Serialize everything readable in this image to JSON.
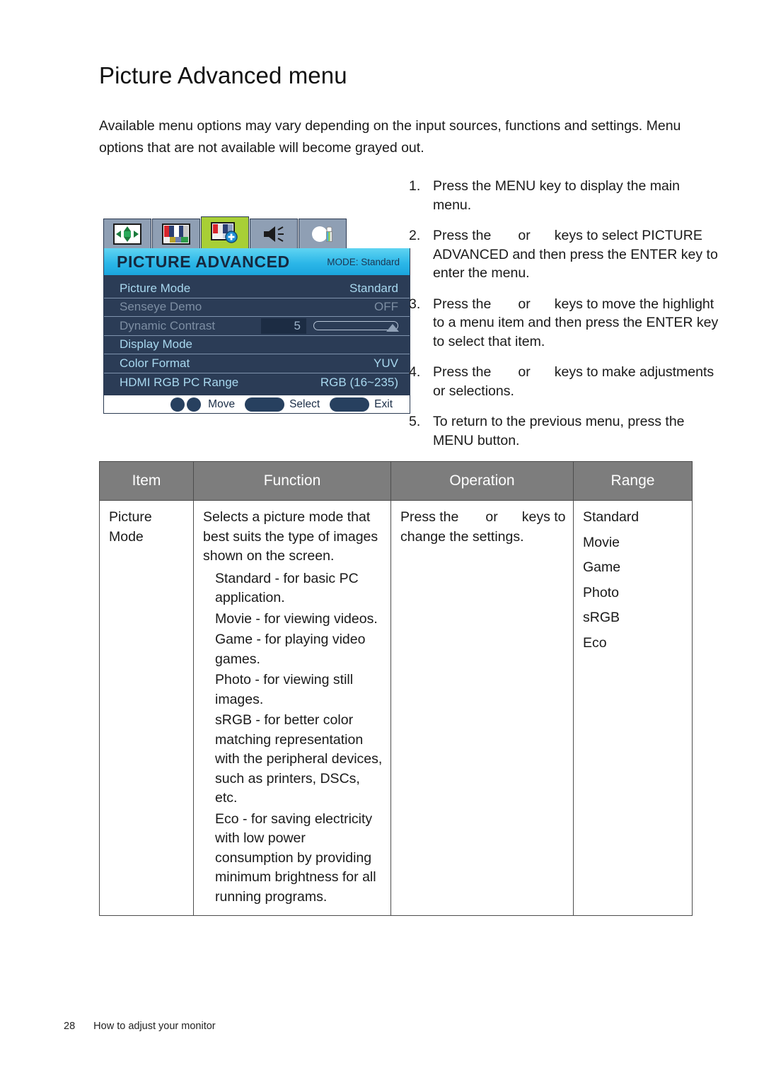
{
  "page": {
    "title": "Picture Advanced menu",
    "intro_line1": "Available menu options may vary depending on the input sources, functions and settings. Menu",
    "intro_line2": "options that are not available will become grayed out."
  },
  "osd": {
    "tabs": [
      {
        "name": "display-tab",
        "icon": "display-arrows-icon",
        "active": false
      },
      {
        "name": "picture-tab",
        "icon": "color-bars-icon",
        "active": false
      },
      {
        "name": "picture-advanced-tab",
        "icon": "color-bars-plus-icon",
        "active": true
      },
      {
        "name": "audio-tab",
        "icon": "speaker-icon",
        "active": false
      },
      {
        "name": "system-tab",
        "icon": "tools-icon",
        "active": false
      }
    ],
    "header_title": "PICTURE ADVANCED",
    "header_mode": "MODE: Standard",
    "rows": [
      {
        "label": "Picture Mode",
        "value": "Standard",
        "dim": false,
        "type": "value"
      },
      {
        "label": "Senseye Demo",
        "value": "OFF",
        "dim": true,
        "type": "value"
      },
      {
        "label": "Dynamic Contrast",
        "value": "5",
        "dim": true,
        "type": "slider"
      },
      {
        "label": "Display Mode",
        "value": "",
        "dim": false,
        "type": "value"
      },
      {
        "label": "Color Format",
        "value": "YUV",
        "dim": false,
        "type": "value"
      },
      {
        "label": "HDMI RGB PC Range",
        "value": "RGB (16~235)",
        "dim": false,
        "type": "value"
      }
    ],
    "footer": {
      "move_label": "Move",
      "select_label": "Select",
      "exit_label": "Exit"
    }
  },
  "steps": [
    {
      "num": "1.",
      "pre": "Press the MENU key to display the main menu.",
      "mid": "",
      "post": ""
    },
    {
      "num": "2.",
      "pre": "Press the",
      "mid": "or",
      "post": "keys to select PICTURE ADVANCED and then press the ENTER key to enter the menu."
    },
    {
      "num": "3.",
      "pre": "Press the",
      "mid": "or",
      "post": "keys to move the highlight to a menu item and then press the ENTER key to select that item."
    },
    {
      "num": "4.",
      "pre": "Press the",
      "mid": "or",
      "post": "keys to make adjustments or selections."
    },
    {
      "num": "5.",
      "pre": "To return to the previous menu, press the MENU button.",
      "mid": "",
      "post": ""
    }
  ],
  "table": {
    "headers": [
      "Item",
      "Function",
      "Operation",
      "Range"
    ],
    "row": {
      "item": "Picture Mode",
      "function_lead": "Selects a picture mode that best suits the type of images shown on the screen.",
      "function_bullets": [
        "Standard - for basic PC application.",
        "Movie - for viewing videos.",
        "Game - for playing video games.",
        "Photo - for viewing still images.",
        "sRGB - for better color matching representation with the peripheral devices, such as printers, DSCs, etc.",
        "Eco - for saving electricity with low power consumption by providing minimum brightness for all running programs."
      ],
      "operation_pre": "Press the",
      "operation_mid": "or",
      "operation_post": "keys to change the settings.",
      "range": [
        "Standard",
        "Movie",
        "Game",
        "Photo",
        "sRGB",
        "Eco"
      ]
    }
  },
  "footer": {
    "page_number": "28",
    "section": "How to adjust your monitor"
  }
}
